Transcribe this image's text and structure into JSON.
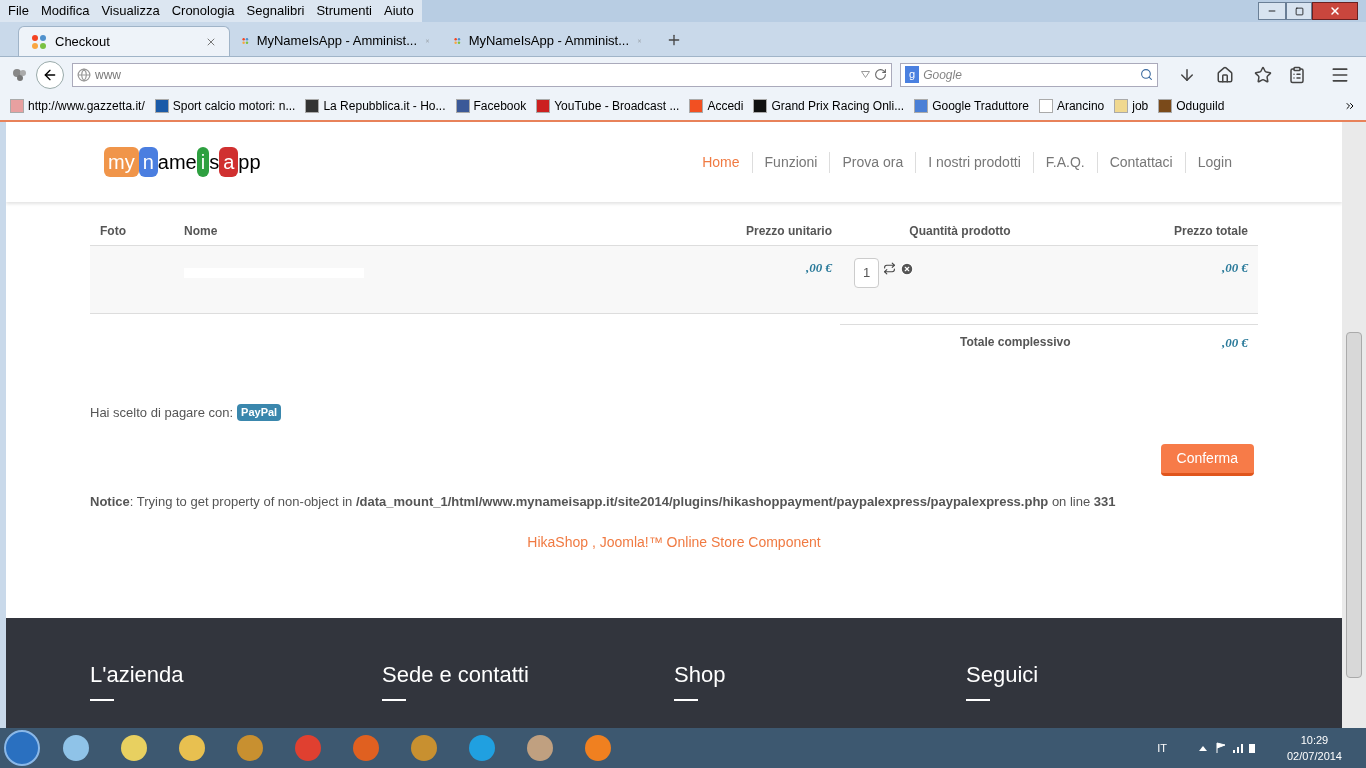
{
  "menu_bar": [
    "File",
    "Modifica",
    "Visualizza",
    "Cronologia",
    "Segnalibri",
    "Strumenti",
    "Aiuto"
  ],
  "tabs": [
    {
      "label": "Checkout",
      "selected": true
    },
    {
      "label": "MyNameIsApp - Amminist...",
      "selected": false
    },
    {
      "label": "MyNameIsApp - Amminist...",
      "selected": false
    }
  ],
  "address_bar": {
    "value": "www"
  },
  "search": {
    "engine_letter": "g",
    "placeholder": "Google"
  },
  "bookmarks": [
    {
      "label": "http://www.gazzetta.it/",
      "color": "#e8a0a0"
    },
    {
      "label": "Sport calcio motori: n...",
      "color": "#1a5aa8"
    },
    {
      "label": "La Repubblica.it - Ho...",
      "color": "#333333"
    },
    {
      "label": "Facebook",
      "color": "#3b5998"
    },
    {
      "label": "YouTube - Broadcast ...",
      "color": "#cc2020"
    },
    {
      "label": "Accedi",
      "color": "#f25022"
    },
    {
      "label": "Grand Prix Racing Onli...",
      "color": "#111111"
    },
    {
      "label": "Google Traduttore",
      "color": "#4a7fd6"
    },
    {
      "label": "Arancino",
      "color": "#ffffff"
    },
    {
      "label": "job",
      "color": "#f0d890"
    },
    {
      "label": "Oduguild",
      "color": "#7a4a1a"
    }
  ],
  "site": {
    "logo": [
      {
        "text": "my",
        "color": "#f0954a"
      },
      {
        "text": "n",
        "color": "#4a7ee0"
      },
      {
        "text": "ame"
      },
      {
        "text": "i",
        "color": "#2ea040"
      },
      {
        "text": "s"
      },
      {
        "text": "a",
        "color": "#d03030"
      },
      {
        "text": "pp"
      }
    ],
    "nav": [
      {
        "label": "Home",
        "selected": true
      },
      {
        "label": "Funzioni",
        "selected": false
      },
      {
        "label": "Prova ora",
        "selected": false
      },
      {
        "label": "I nostri prodotti",
        "selected": false
      },
      {
        "label": "F.A.Q.",
        "selected": false
      },
      {
        "label": "Contattaci",
        "selected": false
      },
      {
        "label": "Login",
        "selected": false
      }
    ]
  },
  "cart": {
    "columns": [
      "Foto",
      "Nome",
      "Prezzo unitario",
      "Quantità prodotto",
      "Prezzo totale"
    ],
    "row": {
      "unit_price": ",00 €",
      "quantity": "1",
      "total_price": ",00 €"
    },
    "total_label": "Totale complessivo",
    "total_value": ",00 €"
  },
  "payment": {
    "label": "Hai scelto di pagare con:",
    "method": "PayPal"
  },
  "confirm_button": "Conferma",
  "notice": "**Notice**: Trying to get property of non-object in **/data_mount_1/html/www.mynameisapp.it/site2014/plugins/hikashoppayment/paypalexpress/paypalexpress.php** on line **331**",
  "credit_link": "HikaShop , Joomla!™ Online Store Component",
  "footer": [
    "L'azienda",
    "Sede e contatti",
    "Shop",
    "Seguici"
  ],
  "taskbar": {
    "language": "IT",
    "time": "10:29",
    "date": "02/07/2014"
  }
}
